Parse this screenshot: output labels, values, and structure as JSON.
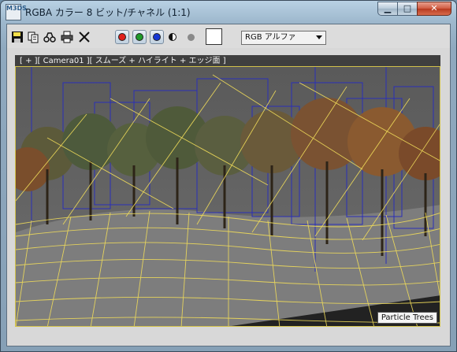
{
  "window": {
    "title": "RGBA カラー 8 ビット/チャネル (1:1)",
    "app_icon_text": "M3DS",
    "controls": {
      "minimize": "▁",
      "maximize": "□",
      "close": "✕"
    }
  },
  "toolbar": {
    "save_icon": "save-icon",
    "copy_icon": "copy-icon",
    "clone_icon": "clone-icon",
    "print_icon": "print-icon",
    "clear_icon": "clear-icon",
    "channels": [
      {
        "name": "red-channel",
        "color": "#e0201c"
      },
      {
        "name": "green-channel",
        "color": "#1f9a2a"
      },
      {
        "name": "blue-channel",
        "color": "#1537d4"
      }
    ],
    "display_mode": "RGB アルファ"
  },
  "viewport": {
    "header": "[ + ][ Camera01 ][ スムーズ + ハイライト + エッジ面 ]",
    "object_label": "Particle Trees",
    "colors": {
      "wire": "#f0dc5a",
      "blue_wire": "#2a2fb8",
      "ground": "#7d7d7d"
    }
  }
}
